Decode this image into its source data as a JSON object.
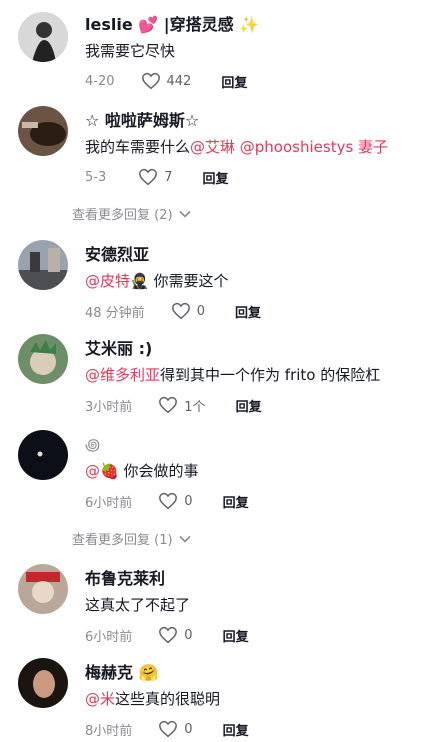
{
  "comments": [
    {
      "name": "leslie",
      "name_suffix": "|穿搭灵感",
      "name_emoji": "💕",
      "name_emoji2": "✨",
      "text": "我需要它尽快",
      "date": "4-20",
      "likes": "442",
      "reply": "回复"
    },
    {
      "name": "☆ 啦啦萨姆斯☆",
      "mentions": "@艾琳 @phooshiestys 妻子",
      "text_prefix": "我的车需要什么",
      "date": "5-3",
      "likes": "7",
      "reply": "回复"
    },
    {
      "name": "安德烈亚",
      "mention": "@皮特",
      "emoji": "🥷",
      "text": " 你需要这个",
      "date": "48 分钟前",
      "likes": "0",
      "reply": "回复"
    },
    {
      "name": "艾米丽 :)",
      "mention": "@维多利亚",
      "text": "得到其中一个作为 frito 的保险杠",
      "date": "3小时前",
      "likes": "1个",
      "reply": "回复"
    },
    {
      "name": "꩜",
      "mention": "@",
      "emoji": "🍓",
      "text": " 你会做的事",
      "date": "6小时前",
      "likes": "0",
      "reply": "回复"
    },
    {
      "name": "布鲁克莱利",
      "text": "这真太了不起了",
      "date": "6小时前",
      "likes": "0",
      "reply": "回复"
    },
    {
      "name": "梅赫克",
      "name_emoji": "🤗",
      "mention": "@米",
      "text": "这些真的很聪明",
      "date": "8小时前",
      "likes": "0",
      "reply": "回复"
    }
  ],
  "view_more_1": "查看更多回复 (2)",
  "view_more_2": "查看更多回复 (1)"
}
